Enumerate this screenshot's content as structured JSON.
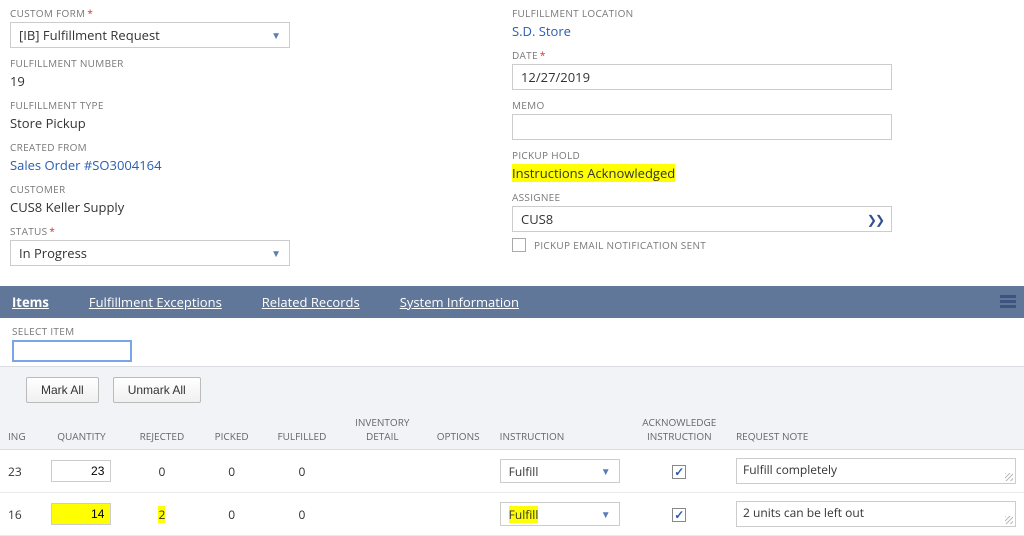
{
  "left": {
    "custom_form_label": "CUSTOM FORM",
    "custom_form_value": "[IB] Fulfillment Request",
    "fulfillment_number_label": "FULFILLMENT NUMBER",
    "fulfillment_number_value": "19",
    "fulfillment_type_label": "FULFILLMENT TYPE",
    "fulfillment_type_value": "Store Pickup",
    "created_from_label": "CREATED FROM",
    "created_from_value": "Sales Order #SO3004164",
    "customer_label": "CUSTOMER",
    "customer_value": "CUS8 Keller Supply",
    "status_label": "STATUS",
    "status_value": "In Progress"
  },
  "right": {
    "fulfillment_location_label": "FULFILLMENT LOCATION",
    "fulfillment_location_value": "S.D. Store",
    "date_label": "DATE",
    "date_value": "12/27/2019",
    "memo_label": "MEMO",
    "memo_value": "",
    "pickup_hold_label": "PICKUP HOLD",
    "pickup_hold_value": "Instructions Acknowledged",
    "assignee_label": "ASSIGNEE",
    "assignee_value": "CUS8",
    "pickup_email_label": "PICKUP EMAIL NOTIFICATION SENT"
  },
  "tabs": {
    "items": "Items",
    "exceptions": "Fulfillment Exceptions",
    "related": "Related Records",
    "system": "System Information"
  },
  "subtab": {
    "select_item_label": "SELECT ITEM",
    "mark_all": "Mark All",
    "unmark_all": "Unmark All"
  },
  "columns": {
    "ing": "ING",
    "quantity": "QUANTITY",
    "rejected": "REJECTED",
    "picked": "PICKED",
    "fulfilled": "FULFILLED",
    "inventory_detail": "INVENTORY DETAIL",
    "options": "OPTIONS",
    "instruction": "INSTRUCTION",
    "ack": "ACKNOWLEDGE INSTRUCTION",
    "request_note": "REQUEST NOTE"
  },
  "rows": [
    {
      "ing": "23",
      "quantity": "23",
      "rejected": "0",
      "picked": "0",
      "fulfilled": "0",
      "instruction": "Fulfill",
      "ack": true,
      "note": "Fulfill completely",
      "hl_qty": false,
      "hl_rej": false,
      "hl_instr": false
    },
    {
      "ing": "16",
      "quantity": "14",
      "rejected": "2",
      "picked": "0",
      "fulfilled": "0",
      "instruction": "Fulfill",
      "ack": true,
      "note": "2 units can be left out",
      "hl_qty": true,
      "hl_rej": true,
      "hl_instr": true
    }
  ]
}
